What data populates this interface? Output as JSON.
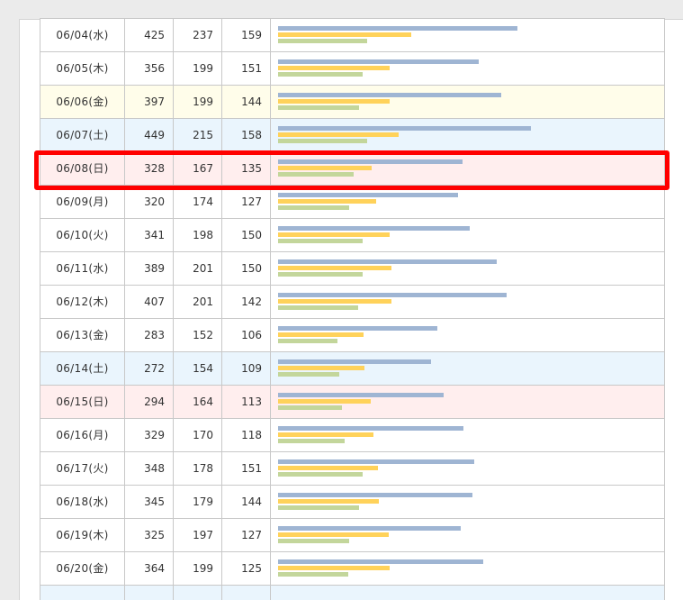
{
  "colors": {
    "bar1": "#9fb5d3",
    "bar2": "#ffd25a",
    "bar3": "#c3d69b",
    "sat_bg": "#eaf5fd",
    "sun_bg": "#ffeeee",
    "holiday_bg": "#fffdea",
    "highlight": "#ff0000"
  },
  "table": {
    "rows": [
      {
        "date": "06/04(水)",
        "v1": "425",
        "v2": "237",
        "v3": "159",
        "bg": ""
      },
      {
        "date": "06/05(木)",
        "v1": "356",
        "v2": "199",
        "v3": "151",
        "bg": ""
      },
      {
        "date": "06/06(金)",
        "v1": "397",
        "v2": "199",
        "v3": "144",
        "bg": "holiday"
      },
      {
        "date": "06/07(土)",
        "v1": "449",
        "v2": "215",
        "v3": "158",
        "bg": "sat"
      },
      {
        "date": "06/08(日)",
        "v1": "328",
        "v2": "167",
        "v3": "135",
        "bg": "sun"
      },
      {
        "date": "06/09(月)",
        "v1": "320",
        "v2": "174",
        "v3": "127",
        "bg": ""
      },
      {
        "date": "06/10(火)",
        "v1": "341",
        "v2": "198",
        "v3": "150",
        "bg": ""
      },
      {
        "date": "06/11(水)",
        "v1": "389",
        "v2": "201",
        "v3": "150",
        "bg": ""
      },
      {
        "date": "06/12(木)",
        "v1": "407",
        "v2": "201",
        "v3": "142",
        "bg": ""
      },
      {
        "date": "06/13(金)",
        "v1": "283",
        "v2": "152",
        "v3": "106",
        "bg": ""
      },
      {
        "date": "06/14(土)",
        "v1": "272",
        "v2": "154",
        "v3": "109",
        "bg": "sat"
      },
      {
        "date": "06/15(日)",
        "v1": "294",
        "v2": "164",
        "v3": "113",
        "bg": "sun"
      },
      {
        "date": "06/16(月)",
        "v1": "329",
        "v2": "170",
        "v3": "118",
        "bg": ""
      },
      {
        "date": "06/17(火)",
        "v1": "348",
        "v2": "178",
        "v3": "151",
        "bg": ""
      },
      {
        "date": "06/18(水)",
        "v1": "345",
        "v2": "179",
        "v3": "144",
        "bg": ""
      },
      {
        "date": "06/19(木)",
        "v1": "325",
        "v2": "197",
        "v3": "127",
        "bg": ""
      },
      {
        "date": "06/20(金)",
        "v1": "364",
        "v2": "199",
        "v3": "125",
        "bg": ""
      },
      {
        "date": "",
        "v1": "",
        "v2": "",
        "v3": "",
        "bg": "sat"
      }
    ]
  }
}
